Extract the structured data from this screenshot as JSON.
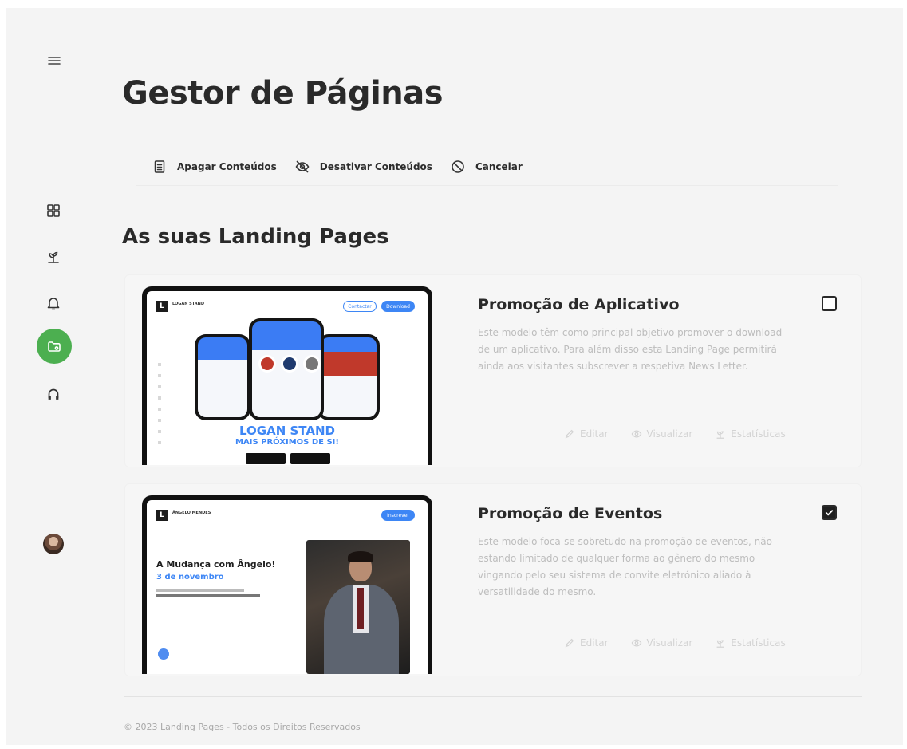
{
  "page": {
    "title": "Gestor de Páginas",
    "section_title": "As suas Landing Pages"
  },
  "sidebar": {
    "items": [
      {
        "name": "menu-icon"
      },
      {
        "name": "dashboard-icon"
      },
      {
        "name": "plant-icon"
      },
      {
        "name": "bell-icon"
      },
      {
        "name": "folder-settings-icon",
        "active": true
      },
      {
        "name": "support-icon"
      },
      {
        "name": "avatar"
      }
    ],
    "accent": "#4caf50"
  },
  "actions": {
    "delete_label": "Apagar Conteúdos",
    "disable_label": "Desativar Conteúdos",
    "cancel_label": "Cancelar"
  },
  "cards": [
    {
      "title": "Promoção de Aplicativo",
      "description": "Este modelo têm como principal objetivo promover o download de um aplicativo. Para além disso esta Landing Page permitirá ainda aos visitantes subscrever a respetiva News Letter.",
      "checked": false,
      "edit_label": "Editar",
      "view_label": "Visualizar",
      "stats_label": "Estatísticas",
      "preview": {
        "logo_letter": "L",
        "brand": "LOGAN STAND",
        "pill_1": "Contactar",
        "pill_2": "Download",
        "headline": "LOGAN STAND",
        "subheadline": "MAIS PRÓXIMOS DE SI!"
      }
    },
    {
      "title": "Promoção de Eventos",
      "description": "Este modelo foca-se sobretudo na promoção de eventos, não estando limitado de qualquer forma ao gênero do mesmo vingando pelo seu sistema de convite eletrónico aliado à versatilidade do mesmo.",
      "checked": true,
      "edit_label": "Editar",
      "view_label": "Visualizar",
      "stats_label": "Estatísticas",
      "preview": {
        "logo_letter": "L",
        "brand": "ÂNGELO MENDES",
        "pill_1": "Inscrever",
        "headline": "A Mudança com Ângelo!",
        "date": "3 de novembro"
      }
    }
  ],
  "footer": {
    "text": "© 2023 Landing Pages - Todos os Direitos Reservados"
  },
  "colors": {
    "accent_blue": "#3d86f5",
    "accent_green": "#4caf50",
    "text_dark": "#2a2a2a",
    "text_muted": "#bdbdbd"
  }
}
